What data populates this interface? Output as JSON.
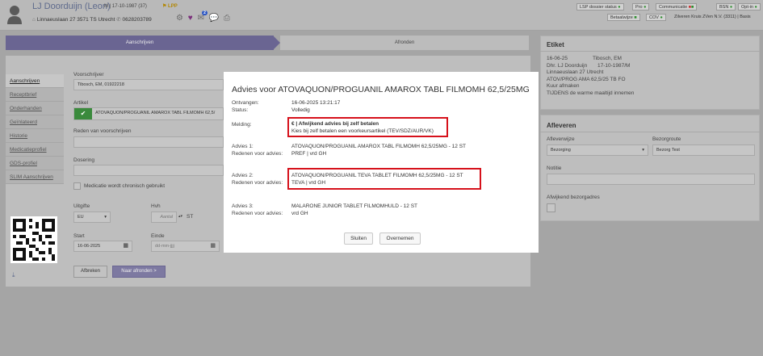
{
  "header": {
    "patient_name": "LJ Doorduijn (Leon)",
    "patient_meta": "M | 17-10-1987 (37)",
    "patient_flag": "LPP",
    "address": "Linnaeuslaan 27 3571 TS Utrecht",
    "phone": "0628203789",
    "message_count": "2",
    "status_badges": [
      "LSP dossier status",
      "Pro",
      "Communicatie",
      "BSN",
      "Opt-in"
    ],
    "status_badges_row2": [
      "Betaalwijze",
      "COV"
    ],
    "insurer": "Zilveren Kruis ZVen N.V. (3311) | Basis"
  },
  "steps": {
    "step1": "Aanschrijven",
    "step2": "Afronden"
  },
  "sidebar": {
    "items": [
      "Aanschrijven",
      "Receptbrief",
      "Onderhanden",
      "Geïnlateerd",
      "Historie",
      "Medicatieprofiel",
      "GDS-profiel",
      "SLIM Aanschrijven"
    ]
  },
  "form": {
    "voorschrijver_label": "Voorschrijver",
    "voorschrijver_value": "Tibosch, EM, 01922218",
    "artikel_label": "Artikel",
    "artikel_value": "ATOVAQUON/PROGUANIL AMAROX TABL FILMOMH 62,5/",
    "reden_label": "Reden van voorschrijven",
    "dosering_label": "Dosering",
    "chronisch_label": "Medicatie wordt chronisch gebruikt",
    "uitgifte_label": "Uitgifte",
    "uitgifte_value": "EU",
    "hvh_label": "Hvh",
    "hvh_placeholder": "Aantal",
    "hvh_unit": "ST",
    "start_label": "Start",
    "start_value": "16-06-2025",
    "einde_label": "Einde",
    "einde_placeholder": "dd-mm-jjjj",
    "afbreken": "Afbreken",
    "naar_afronden": "Naar afronden >"
  },
  "etiket": {
    "title": "Etiket",
    "lines": [
      "16-06-25",
      "Dhr. LJ Doorduijn",
      "Linnaeuslaan 27  Utrecht",
      "ATOV/PROG AMA 62,5/25 TB FO",
      "Kuur afmaken",
      "TIJDENS de warme maaltijd innemen"
    ],
    "right_lines": [
      "Tibosch, EM",
      "17-10-1987/M"
    ]
  },
  "afleveren": {
    "title": "Afleveren",
    "afleverwijze_label": "Afleverwijze",
    "afleverwijze_value": "Bezorging",
    "bezorgroute_label": "Bezorgroute",
    "bezorgroute_value": "Bezorg Test",
    "notitie_label": "Notitie",
    "afwijkend_label": "Afwijkend bezorgadres"
  },
  "modal": {
    "title": "Advies voor ATOVAQUON/PROGUANIL AMAROX TABL FILMOMH 62,5/25MG",
    "ontvangen_label": "Ontvangen:",
    "ontvangen_value": "16-06-2025 13:21:17",
    "status_label": "Status:",
    "status_value": "Volledig",
    "melding_label": "Melding:",
    "melding_title": "€ | Afwijkend advies bij zelf betalen",
    "melding_text": "Kies bij zelf betalen een voorkeursartikel (TEV/SDZ/AUR/VK)",
    "adviezen": [
      {
        "label": "Advies 1:",
        "value": "ATOVAQUON/PROGUANIL AMAROX TABL FILMOMH 62,5/25MG - 12 ST",
        "reden_label": "Redenen voor advies:",
        "reden": "PREF | vrd GH"
      },
      {
        "label": "Advies 2:",
        "value": "ATOVAQUON/PROGUANIL TEVA TABLET FILMOMH  62,5/25MG - 12 ST",
        "reden_label": "Redenen voor advies:",
        "reden": "TEVA | vrd GH"
      },
      {
        "label": "Advies 3:",
        "value": "MALARONE JUNIOR TABLET FILMOMHULD - 12 ST",
        "reden_label": "Redenen voor advies:",
        "reden": "vrd GH"
      }
    ],
    "sluiten": "Sluiten",
    "overnemen": "Overnemen"
  },
  "colors": {
    "highlight": "#d6111b",
    "step_active": "#6a6592",
    "artikel_check": "#3a8a3c",
    "name_link": "#5e6a8c"
  }
}
